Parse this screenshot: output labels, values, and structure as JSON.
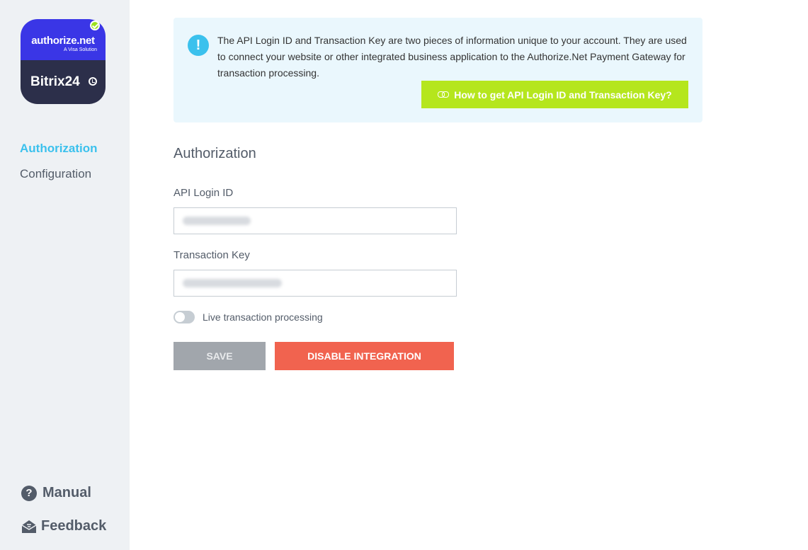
{
  "sidebar": {
    "logo": {
      "brand": "authorize.net",
      "subtitle": "A Visa Solution",
      "product": "Bitrix24"
    },
    "nav": [
      {
        "label": "Authorization",
        "active": true
      },
      {
        "label": "Configuration",
        "active": false
      }
    ],
    "bottom": {
      "manual_label": "Manual",
      "feedback_label": "Feedback"
    }
  },
  "info": {
    "text": "The API Login ID and Transaction Key are two pieces of information unique to your account. They are used to connect your website or other integrated business application to the Authorize.Net Payment Gateway for transaction processing.",
    "button_label": "How to get API Login ID and Transaction Key?"
  },
  "form": {
    "title": "Authorization",
    "api_login_label": "API Login ID",
    "api_login_value": "",
    "transaction_key_label": "Transaction Key",
    "transaction_key_value": "",
    "live_toggle_label": "Live transaction processing",
    "live_toggle_on": false,
    "save_label": "SAVE",
    "disable_label": "DISABLE INTEGRATION"
  },
  "colors": {
    "accent": "#3bc1ed",
    "link_button": "#b5e61d",
    "danger": "#f1634f",
    "disabled": "#a1a6ac"
  }
}
